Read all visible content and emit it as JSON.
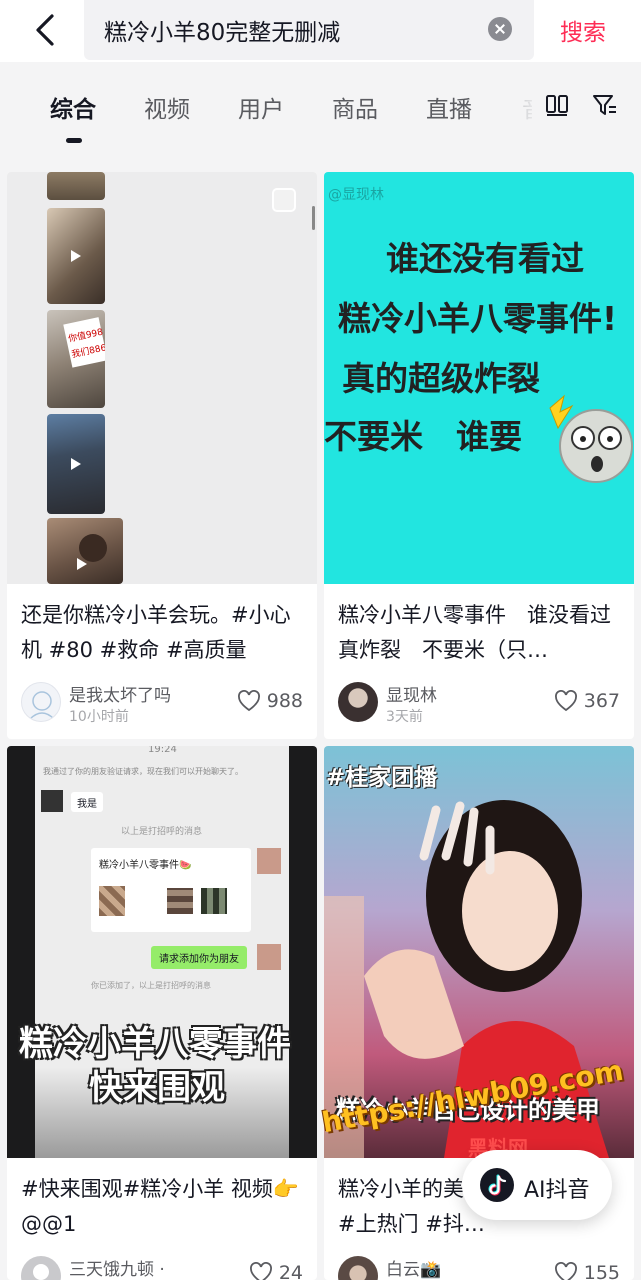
{
  "search": {
    "query": "糕冷小羊80完整无删减",
    "button_label": "搜索"
  },
  "tabs": [
    {
      "label": "综合",
      "active": true
    },
    {
      "label": "视频",
      "active": false
    },
    {
      "label": "用户",
      "active": false
    },
    {
      "label": "商品",
      "active": false
    },
    {
      "label": "直播",
      "active": false
    }
  ],
  "icons": {
    "back": "chevron-left-icon",
    "clear": "clear-icon",
    "layout": "two-column-layout-icon",
    "filter": "filter-icon",
    "like": "heart-outline-icon"
  },
  "colors": {
    "accent": "#fe2c55",
    "card_cyan": "#22e5e0",
    "red_dress": "#e0242e"
  },
  "results": [
    {
      "title": "还是你糕冷小羊会玩。#小心机 #80 #救命 #高质量",
      "author": "是我太坏了吗",
      "time": "10小时前",
      "likes": "988",
      "thumb_labels": [
        "你值998",
        "我们886"
      ]
    },
    {
      "title": "糕冷小羊八零事件　谁没看过　真炸裂　不要米（只…",
      "author": "显现林",
      "time": "3天前",
      "likes": "367",
      "cover_watermark": "@显现林",
      "cover_lines": [
        "谁还没有看过",
        "糕冷小羊八零事件!",
        "真的超级炸裂",
        "不要米　谁要"
      ]
    },
    {
      "title": "#快来围观#糕冷小羊 视频👉@@1",
      "author": "三天饿九顿 ·",
      "likes": "24",
      "cover_time": "19:24",
      "cover_chat": {
        "system_msg": "我通过了你的朋友验证请求，现在我们可以开始聊天了。",
        "me_label": "我是",
        "greeting_note": "以上是打招呼的消息",
        "card_title": "糕冷小羊八零事件🍉",
        "request": "请求添加你为朋友",
        "added_note": "你已添加了，以上是打招呼的消息"
      },
      "cover_overlay": [
        "糕冷小羊八零事件",
        "快来围观"
      ]
    },
    {
      "title": "糕冷小羊的美甲　#桂家团播 #上热门 #抖…",
      "author": "白云📸",
      "likes": "155",
      "cover_tag": "#桂家团播",
      "cover_caption": "糕冷小羊自己设计的美甲"
    }
  ],
  "overlays": {
    "url_watermark": "https://hlwb09.com",
    "site_watermark": "黑料网",
    "ai_button": "AI抖音"
  }
}
